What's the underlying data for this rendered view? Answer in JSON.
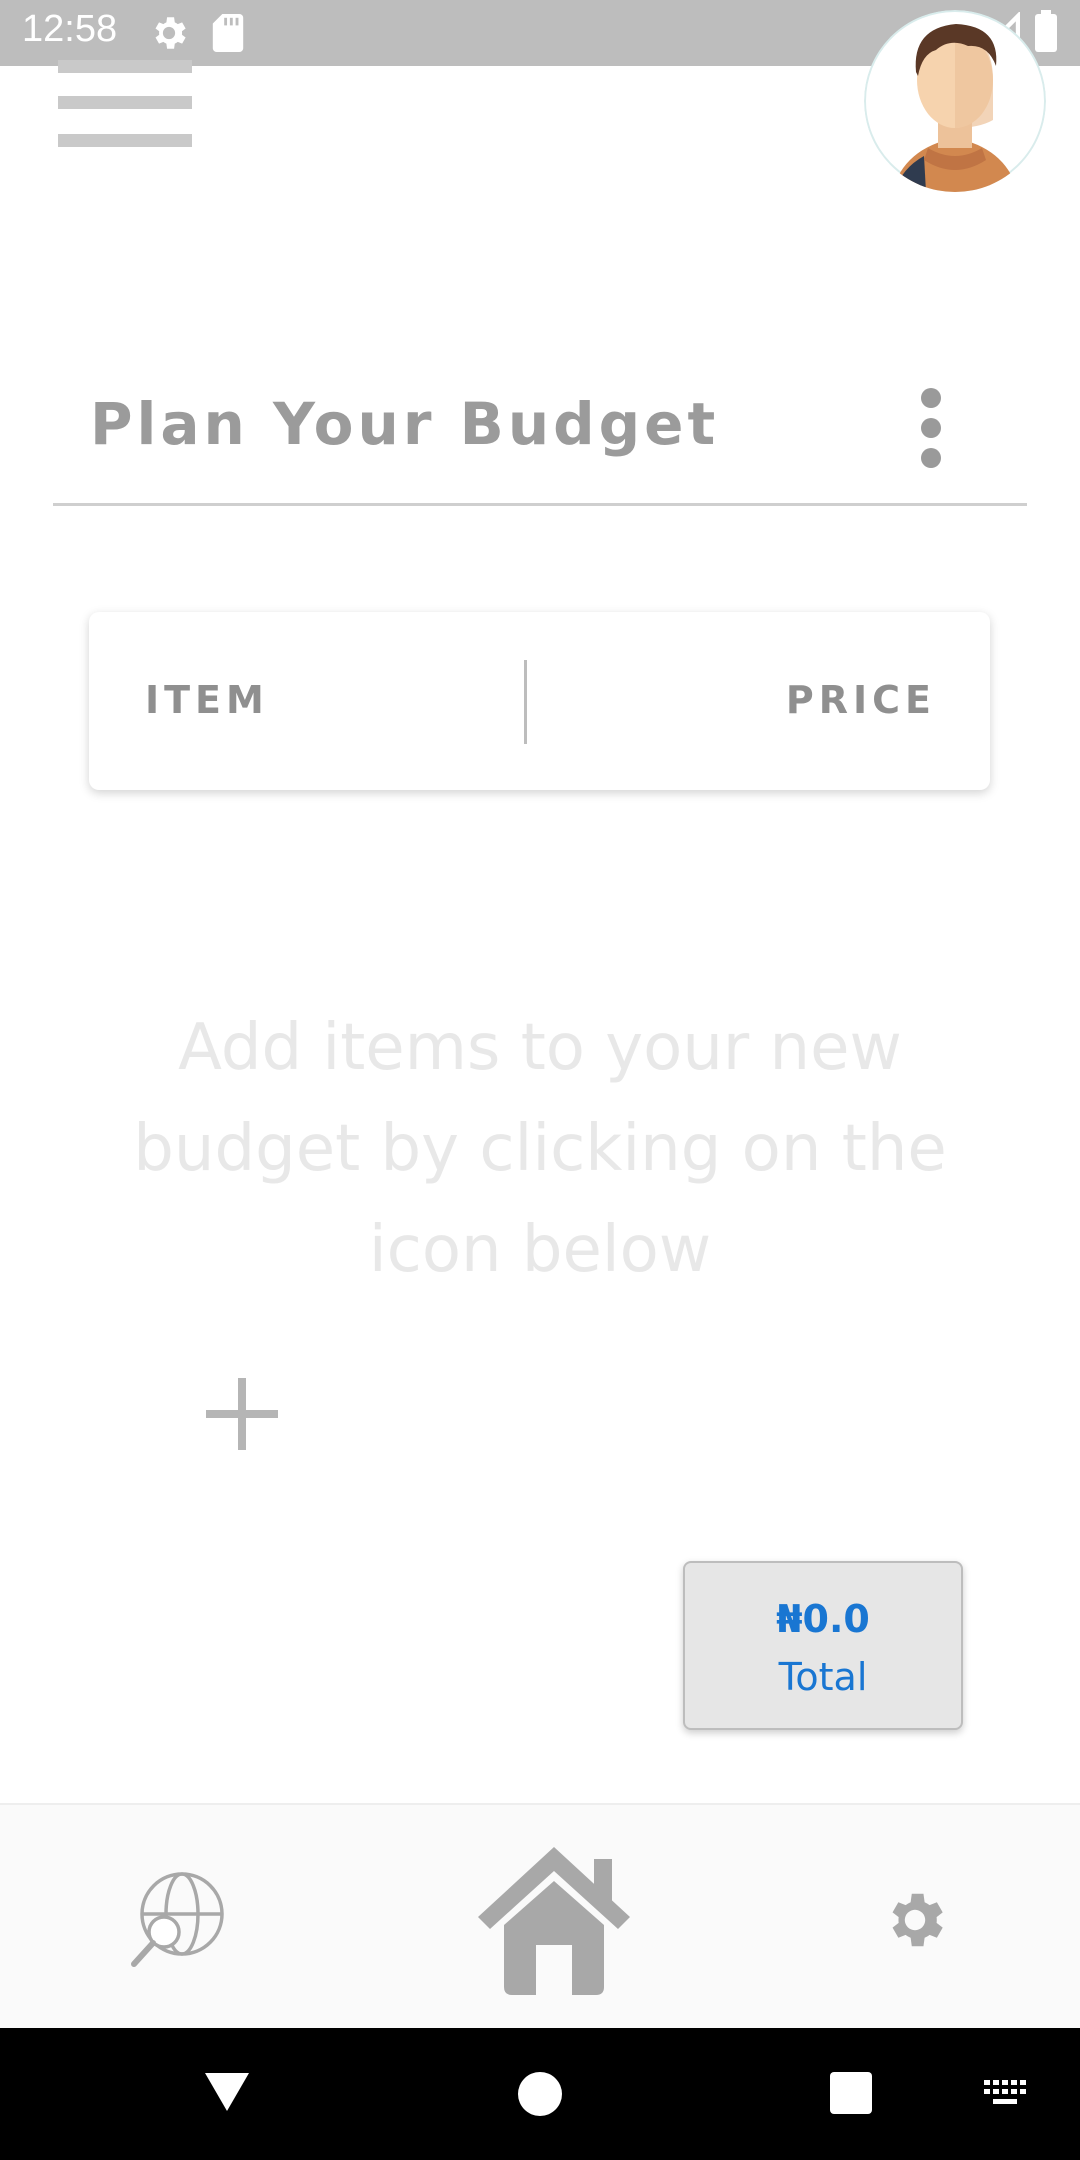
{
  "status_bar": {
    "time": "12:58",
    "icons": [
      "settings-icon",
      "sd-card-icon",
      "wifi-icon",
      "signal-icon",
      "battery-icon"
    ]
  },
  "header": {
    "menu_icon": "hamburger-menu-icon",
    "avatar": "user-avatar"
  },
  "page": {
    "title": "Plan Your Budget",
    "more_icon": "more-vertical-icon"
  },
  "table": {
    "col_item": "ITEM",
    "col_price": "PRICE"
  },
  "empty_state": {
    "line1": "Add items to your new",
    "line2": "budget by clicking on the",
    "line3": "icon below",
    "add_icon": "plus-icon"
  },
  "total": {
    "amount": "₦0.0",
    "label": "Total"
  },
  "bottom_nav": {
    "items": [
      "explore-icon",
      "home-icon",
      "settings-icon"
    ]
  },
  "colors": {
    "accent": "#1976d2",
    "status_bar": "#bdbdbd",
    "muted_text": "#9b9b9b",
    "icon_gray": "#a8a8a8"
  }
}
